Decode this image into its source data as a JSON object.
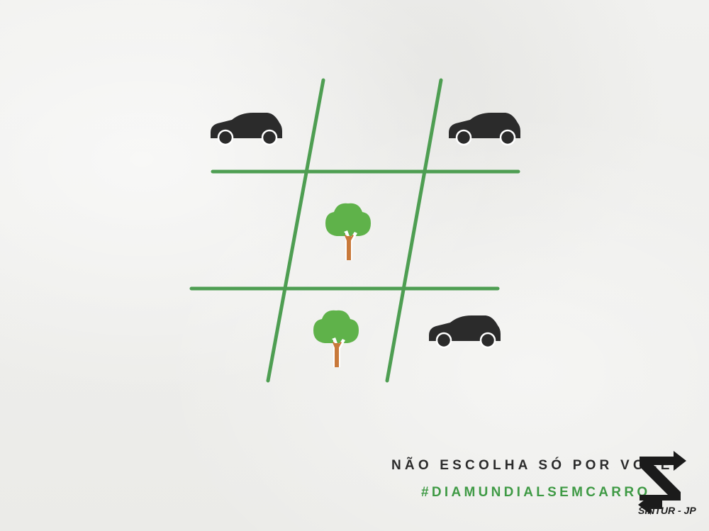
{
  "tagline": "NÃO ESCOLHA SÓ POR VOCÊ.",
  "hashtag": "#DIAMUNDIALSEMCARRO",
  "brand": {
    "name": "SINTUR - JP",
    "logo_icon": "sintur-s-arrows-logo"
  },
  "board": {
    "grid_color": "#4e9e52",
    "cells": {
      "top_left": "car-icon",
      "top_center": "",
      "top_right": "car-icon",
      "middle_left": "",
      "middle_center": "tree-icon",
      "middle_right": "",
      "bottom_left": "",
      "bottom_center": "tree-icon",
      "bottom_right": "car-icon"
    }
  },
  "colors": {
    "car": "#2a2a2a",
    "tree_crown": "#5fb24a",
    "tree_trunk": "#c8793a",
    "tagline": "#2b2b2b",
    "hashtag": "#3f9a45"
  }
}
